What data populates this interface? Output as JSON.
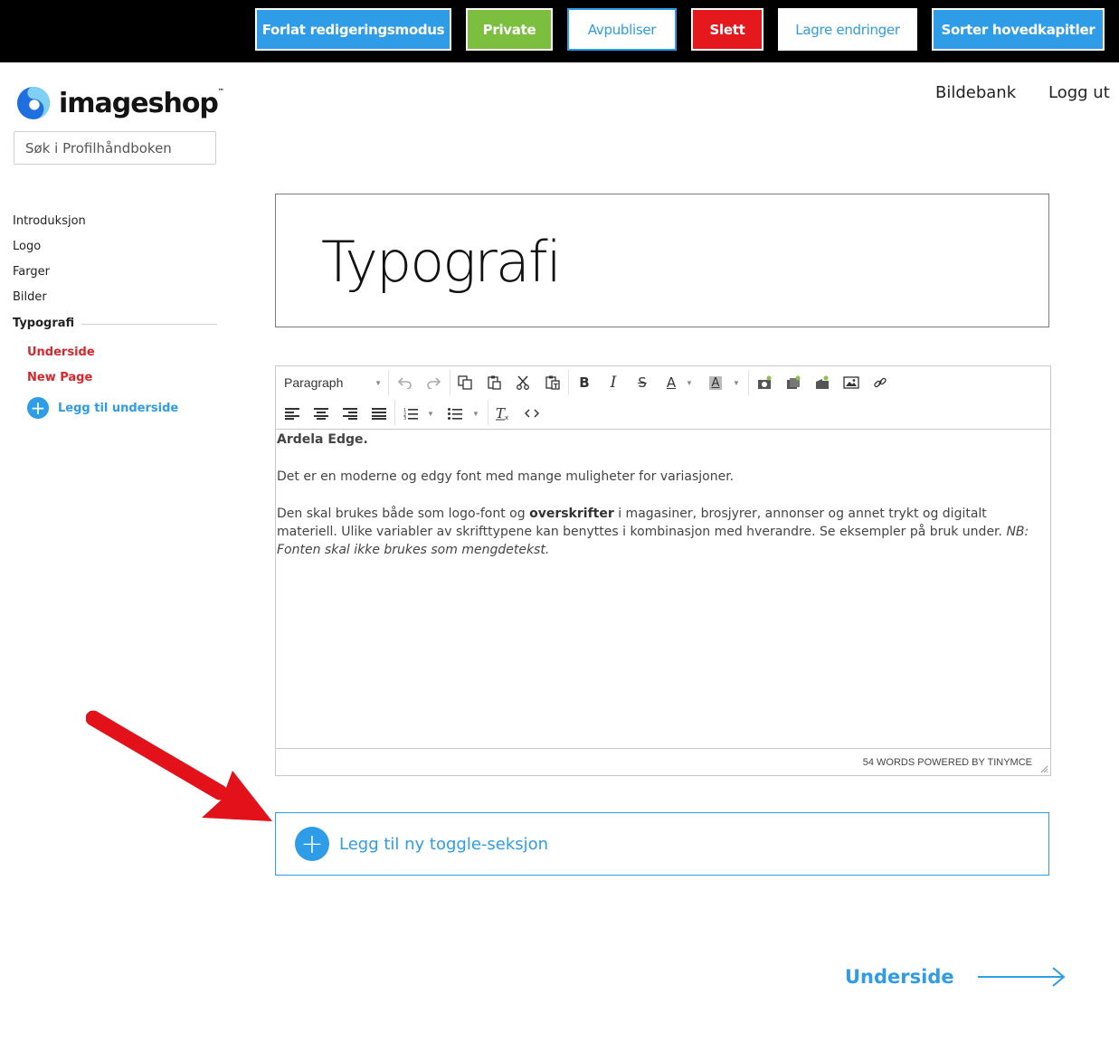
{
  "topbar": {
    "buttons": [
      {
        "label": "Forlat redigeringsmodus",
        "style": "blue"
      },
      {
        "label": "Private",
        "style": "green"
      },
      {
        "label": "Avpubliser",
        "style": "white"
      },
      {
        "label": "Slett",
        "style": "red"
      },
      {
        "label": "Lagre endringer",
        "style": "white"
      },
      {
        "label": "Sorter hovedkapitler",
        "style": "blue"
      }
    ]
  },
  "header": {
    "brand": "imageshop",
    "brand_tm": "™",
    "search_placeholder": "Søk i Profilhåndboken",
    "nav": [
      "Bildebank",
      "Logg ut"
    ]
  },
  "sidebar": {
    "items": [
      "Introduksjon",
      "Logo",
      "Farger",
      "Bilder",
      "Typografi"
    ],
    "active": "Typografi",
    "subitems": [
      "Underside",
      "New Page"
    ],
    "add_sub_label": "Legg til underside"
  },
  "page": {
    "title": "Typografi"
  },
  "editor": {
    "format": "Paragraph",
    "content": {
      "heading": "Ardela Edge.",
      "p1": "Det er en moderne og edgy font med mange muligheter for variasjoner.",
      "p2_before": "Den skal brukes både som logo-font og ",
      "p2_bold": "overskrifter",
      "p2_after": " i magasiner, brosjyrer, annonser og annet trykt og digitalt materiell. Ulike variabler av skrifttypene kan benyttes i kombinasjon med hverandre. Se eksempler på bruk under. ",
      "p2_italic": "NB: Fonten skal ikke brukes som mengdetekst."
    },
    "status": "54 WORDS POWERED BY TINYMCE"
  },
  "toggle": {
    "label": "Legg til ny toggle-seksjon"
  },
  "next": {
    "label": "Underside"
  },
  "colors": {
    "accent": "#2e9ce6",
    "danger": "#e5181e",
    "success": "#7cbf3f",
    "subnav": "#d8262c"
  }
}
